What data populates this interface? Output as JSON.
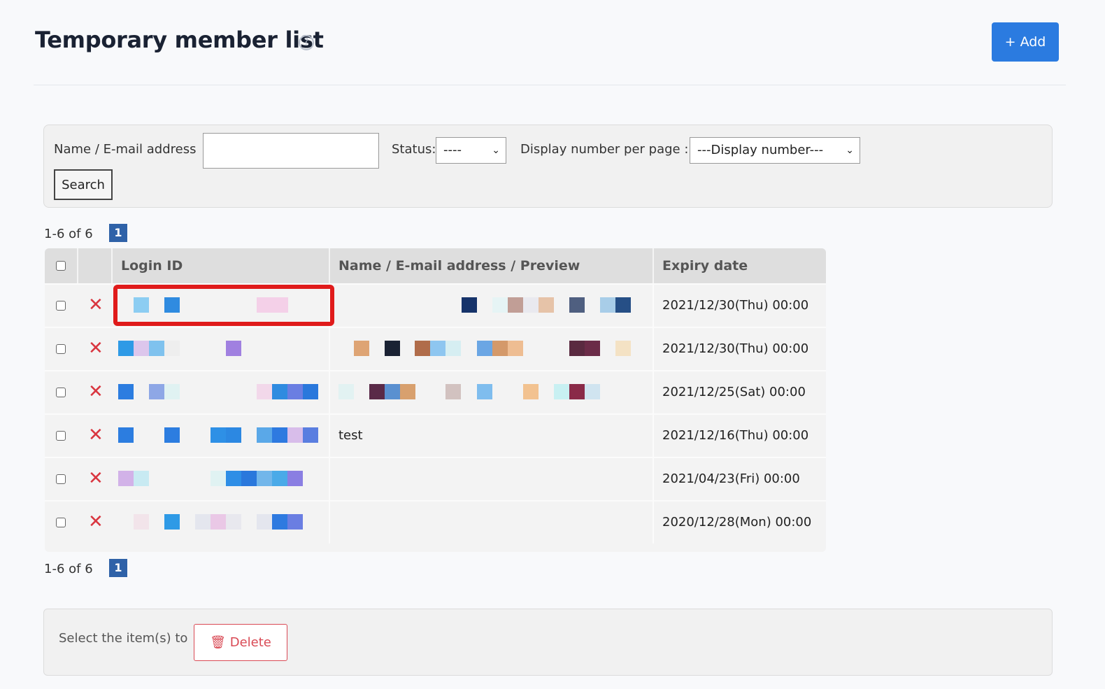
{
  "page": {
    "title": "Temporary member list",
    "add_label": "+ Add"
  },
  "filter": {
    "name_label": "Name / E-mail address",
    "name_value": "",
    "status_label": "Status:",
    "status_value": "----",
    "display_label": "Display number per page :",
    "display_value": "---Display number---",
    "search_label": "Search"
  },
  "pagination": {
    "range_text": "1-6 of 6",
    "current_page": "1"
  },
  "table": {
    "columns": [
      "Login ID",
      "Name / E-mail address / Preview",
      "Expiry date"
    ],
    "rows": [
      {
        "name": "",
        "expiry": "2021/12/30(Thu) 00:00"
      },
      {
        "name": "",
        "expiry": "2021/12/30(Thu) 00:00"
      },
      {
        "name": "",
        "expiry": "2021/12/25(Sat) 00:00"
      },
      {
        "name": "test",
        "expiry": "2021/12/16(Thu) 00:00"
      },
      {
        "name": "",
        "expiry": "2021/04/23(Fri) 00:00"
      },
      {
        "name": "",
        "expiry": "2020/12/28(Mon) 00:00"
      }
    ]
  },
  "bulk": {
    "select_text": "Select the item(s) to",
    "delete_label": "Delete"
  },
  "colors": {
    "primary": "#2b7be0",
    "danger": "#d9353f",
    "highlight": "#e01b1b",
    "page_badge": "#2f62a8"
  }
}
